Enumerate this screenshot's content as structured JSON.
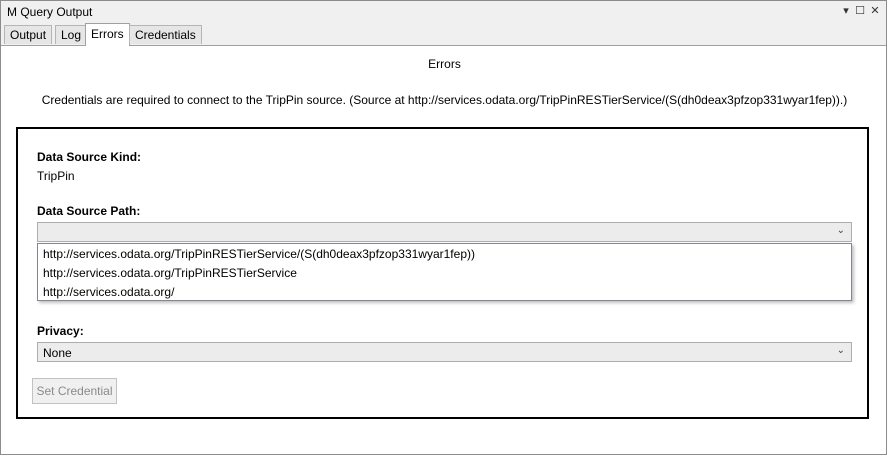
{
  "window": {
    "title": "M Query Output",
    "controls": {
      "dropdown_icon": "▾",
      "maximize_icon": "☐",
      "close_icon": "✕"
    }
  },
  "tabs": [
    {
      "label": "Output",
      "active": false
    },
    {
      "label": "Log",
      "active": false
    },
    {
      "label": "Errors",
      "active": true
    },
    {
      "label": "Credentials",
      "active": false
    }
  ],
  "errors": {
    "heading": "Errors",
    "message": "Credentials are required to connect to the TripPin source. (Source at http://services.odata.org/TripPinRESTierService/(S(dh0deax3pfzop331wyar1fep)).)"
  },
  "form": {
    "kind_label": "Data Source Kind:",
    "kind_value": "TripPin",
    "path_label": "Data Source Path:",
    "path_value": "",
    "path_options": [
      "http://services.odata.org/TripPinRESTierService/(S(dh0deax3pfzop331wyar1fep))",
      "http://services.odata.org/TripPinRESTierService",
      "http://services.odata.org/"
    ],
    "privacy_label": "Privacy:",
    "privacy_value": "None",
    "set_credential_label": "Set Credential",
    "set_credential_enabled": false
  },
  "icons": {
    "chevron": "⌄"
  }
}
